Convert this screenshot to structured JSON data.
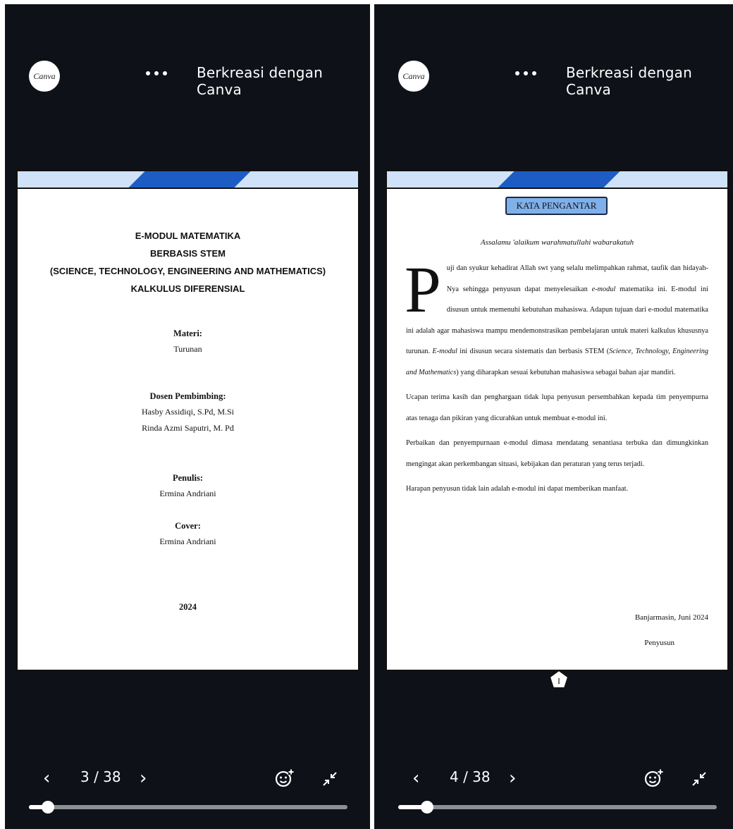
{
  "left": {
    "header": {
      "logo": "Canva",
      "more_icon": "more-horizontal-icon",
      "brand_text": "Berkreasi dengan Canva"
    },
    "page": {
      "title_lines": [
        "E-MODUL MATEMATIKA",
        "BERBASIS STEM",
        "(SCIENCE, TECHNOLOGY, ENGINEERING AND MATHEMATICS)",
        "KALKULUS DIFERENSIAL"
      ],
      "materi_label": "Materi:",
      "materi_value": "Turunan",
      "dosen_label": "Dosen Pembimbing:",
      "dosen_1": "Hasby Assidiqi, S.Pd, M.Si",
      "dosen_2": "Rinda Azmi Saputri, M. Pd",
      "penulis_label": "Penulis:",
      "penulis_value": "Ermina Andriani",
      "cover_label": "Cover:",
      "cover_value": "Ermina Andriani",
      "year": "2024"
    },
    "footer": {
      "prev": "‹",
      "page_indicator": "3 / 38",
      "next": "›",
      "progress": 0.06
    }
  },
  "right": {
    "header": {
      "logo": "Canva",
      "more_icon": "more-horizontal-icon",
      "brand_text": "Berkreasi dengan Canva"
    },
    "page": {
      "heading": "KATA PENGANTAR",
      "greeting": "Assalamu 'alaikum warahmatullahi wabarakatuh",
      "drop_cap": "P",
      "p1_a": "uji dan syukur kehadirat Allah swt yang selalu melimpahkan rahmat, taufik dan hidayah-Nya sehingga penyusun dapat menyelesaikan ",
      "p1_em1": "e-modul",
      "p1_b": " matematika ini. E-modul ini disusun untuk memenuhi kebutuhan mahasiswa. Adapun tujuan dari e-modul matematika ini adalah agar mahasiswa mampu mendemonstrasikan pembelajaran untuk materi kalkulus khususnya turunan. ",
      "p1_em2": "E-modul",
      "p1_c": " ini disusun secara sistematis dan berbasis STEM (",
      "p1_em3": "Science, Technology, Engineering and Mathematics",
      "p1_d": ") yang diharapkan sesuai kebutuhan mahasiswa sebagai bahan ajar mandiri.",
      "p2": "Ucapan terima kasih dan penghargaan tidak lupa penyusun persembahkan kepada tim penyempurna atas tenaga dan pikiran yang dicurahkan untuk membuat e-modul ini.",
      "p3": "Perbaikan dan penyempurnaan e-modul dimasa mendatang senantiasa terbuka dan dimungkinkan mengingat akan perkembangan situasi, kebijakan dan peraturan yang terus terjadi.",
      "p4": "Harapan penyusun tidak lain adalah e-modul ini dapat memberikan manfaat.",
      "sign_place": "Banjarmasin, Juni 2024",
      "sign_name": "Penyusun",
      "page_number": "I"
    },
    "footer": {
      "prev": "‹",
      "page_indicator": "4 / 38",
      "next": "›",
      "progress": 0.09
    }
  },
  "colors": {
    "app_bg": "#0e1218",
    "band_light": "#cfe2f8",
    "band_dark": "#1d5cc4",
    "heading_box": "#7fb0ea"
  }
}
